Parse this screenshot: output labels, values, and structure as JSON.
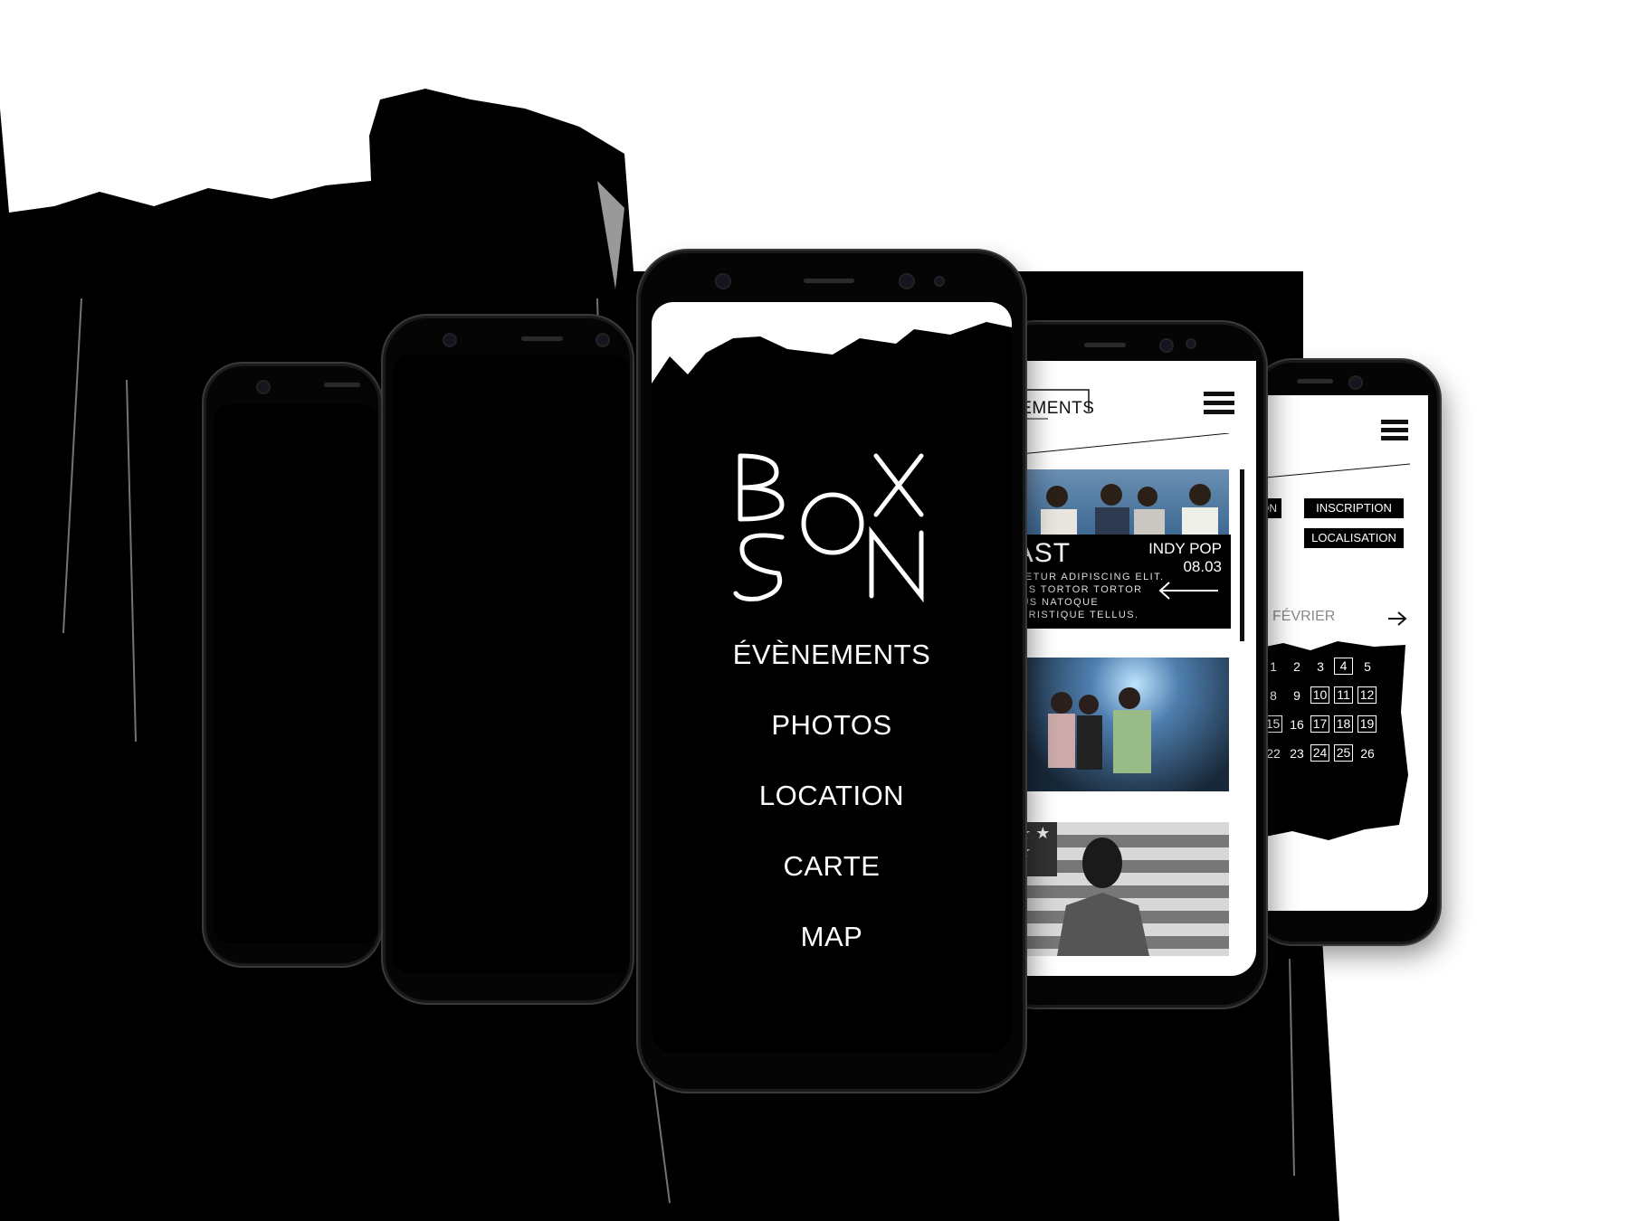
{
  "background_colors": {
    "paint": "#000000",
    "canvas": "#ffffff"
  },
  "center_phone": {
    "logo_letters": [
      "B",
      "O",
      "X",
      "S",
      "O",
      "N"
    ],
    "menu": [
      "ÉVÈNEMENTS",
      "PHOTOS",
      "LOCATION",
      "CARTE",
      "MAP"
    ]
  },
  "events_phone": {
    "title": "NEMENTS",
    "menu_icon": "hamburger-icon",
    "featured": {
      "band_name": "LAST",
      "genre": "INDY POP",
      "date": "08.03",
      "description": [
        "SECTETUR ADIPISCING ELIT.",
        "M QUIS TORTOR TORTOR",
        "VARIUS NATOQUE",
        "LEO TRISTIQUE TELLUS."
      ],
      "back_icon": "arrow-left-icon"
    }
  },
  "calendar_phone": {
    "menu_icon": "hamburger-icon",
    "tabs": [
      "ON",
      "INSCRIPTION",
      "LOCALISATION"
    ],
    "month": "FÉVRIER",
    "next_icon": "arrow-right-icon",
    "weeks": [
      [
        {
          "d": "1",
          "b": false
        },
        {
          "d": "2",
          "b": false
        },
        {
          "d": "3",
          "b": false
        },
        {
          "d": "4",
          "b": true
        },
        {
          "d": "5",
          "b": false
        }
      ],
      [
        {
          "d": "8",
          "b": false
        },
        {
          "d": "9",
          "b": false
        },
        {
          "d": "10",
          "b": true
        },
        {
          "d": "11",
          "b": true
        },
        {
          "d": "12",
          "b": true
        }
      ],
      [
        {
          "d": "15",
          "b": true
        },
        {
          "d": "16",
          "b": false
        },
        {
          "d": "17",
          "b": true
        },
        {
          "d": "18",
          "b": true
        },
        {
          "d": "19",
          "b": true
        }
      ],
      [
        {
          "d": "22",
          "b": false
        },
        {
          "d": "23",
          "b": false
        },
        {
          "d": "24",
          "b": true
        },
        {
          "d": "25",
          "b": true
        },
        {
          "d": "26",
          "b": false
        }
      ]
    ]
  }
}
